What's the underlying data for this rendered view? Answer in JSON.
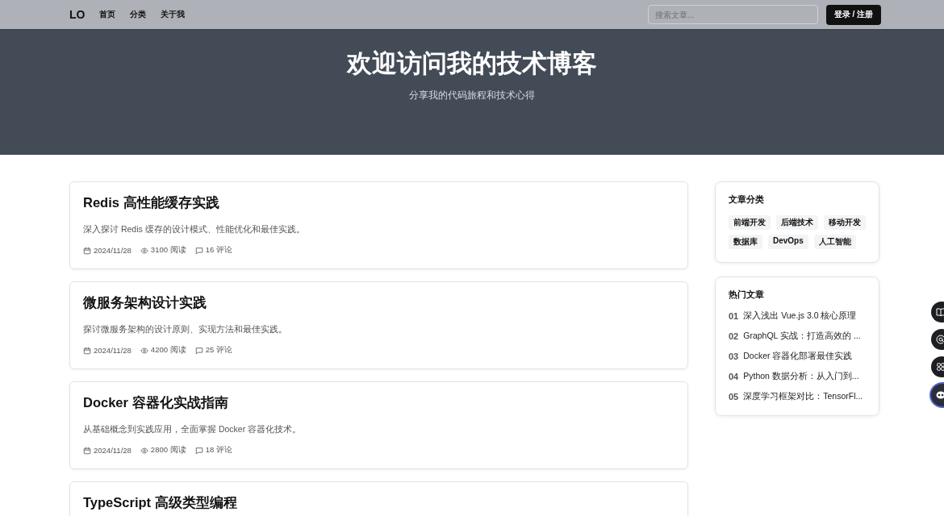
{
  "nav": {
    "logo": "LO",
    "links": [
      "首页",
      "分类",
      "关于我"
    ],
    "search": {
      "placeholder": "搜索文章..."
    },
    "login": "登录 / 注册"
  },
  "hero": {
    "title": "欢迎访问我的技术博客",
    "subtitle": "分享我的代码旅程和技术心得"
  },
  "posts": [
    {
      "title": "Redis 高性能缓存实践",
      "summary": "深入探讨 Redis 缓存的设计模式、性能优化和最佳实践。",
      "date": "2024/11/28",
      "views": "3100 阅读",
      "comments": "16 评论"
    },
    {
      "title": "微服务架构设计实践",
      "summary": "探讨微服务架构的设计原则、实现方法和最佳实践。",
      "date": "2024/11/28",
      "views": "4200 阅读",
      "comments": "25 评论"
    },
    {
      "title": "Docker 容器化实战指南",
      "summary": "从基础概念到实践应用，全面掌握 Docker 容器化技术。",
      "date": "2024/11/28",
      "views": "2800 阅读",
      "comments": "18 评论"
    },
    {
      "title": "TypeScript 高级类型编程"
    }
  ],
  "categories": {
    "title": "文章分类",
    "tags": [
      "前端开发",
      "后端技术",
      "移动开发",
      "数据库",
      "DevOps",
      "人工智能"
    ]
  },
  "popular": {
    "title": "热门文章",
    "items": [
      {
        "rank": "01",
        "title": "深入浅出 Vue.js 3.0 核心原理"
      },
      {
        "rank": "02",
        "title": "GraphQL 实战：打造高效的 ..."
      },
      {
        "rank": "03",
        "title": "Docker 容器化部署最佳实践"
      },
      {
        "rank": "04",
        "title": "Python 数据分析：从入门到..."
      },
      {
        "rank": "05",
        "title": "深度学习框架对比：TensorFl..."
      }
    ]
  },
  "float_buttons": [
    {
      "kind": "book"
    },
    {
      "kind": "at"
    },
    {
      "kind": "grid"
    },
    {
      "kind": "bot"
    }
  ]
}
